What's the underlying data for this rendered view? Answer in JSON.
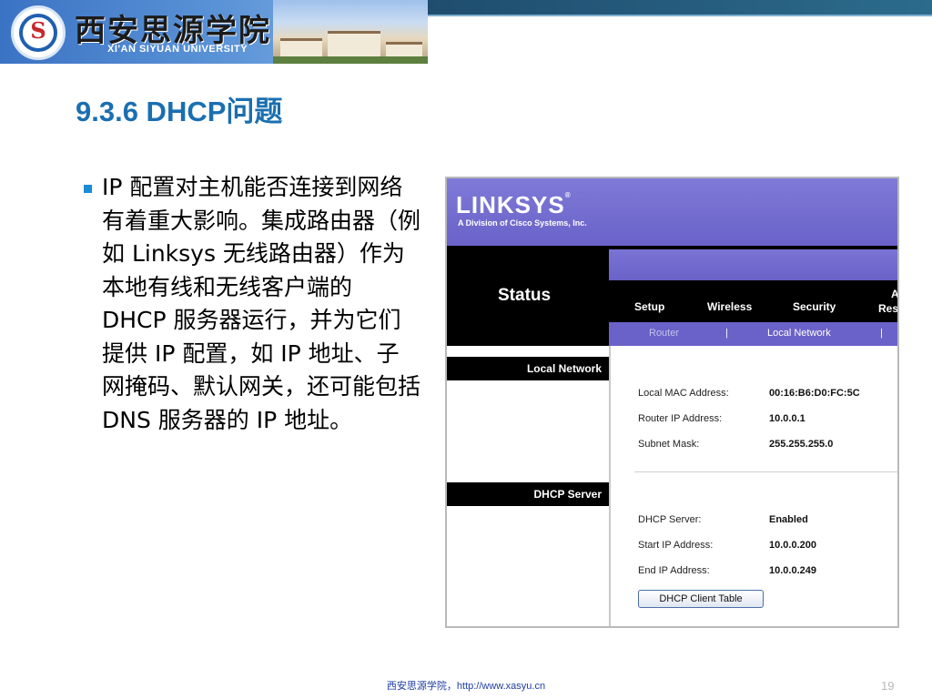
{
  "header": {
    "logo_mark": "S",
    "title": "西安思源学院",
    "subtitle": "XI'AN SIYUAN UNIVERSITY"
  },
  "slide": {
    "title": "9.3.6 DHCP问题",
    "bullet_text": "IP 配置对主机能否连接到网络有着重大影响。集成路由器（例如 Linksys 无线路由器）作为本地有线和无线客户端的 DHCP 服务器运行，并为它们提供 IP 配置，如 IP 地址、子网掩码、默认网关，还可能包括 DNS 服务器的 IP 地址。",
    "bullet_icon": "square-bullet-icon",
    "bullet_color": "#1a8bd6",
    "title_color": "#1a6fb0"
  },
  "router_ui": {
    "brand": "LINKSYS",
    "brand_mark": "®",
    "tagline": "A Division of Cisco Systems, Inc.",
    "page_label": "Status",
    "tabs": [
      "Setup",
      "Wireless",
      "Security",
      "A",
      "Res"
    ],
    "subtabs": [
      "Router",
      "|",
      "Local Network",
      "|"
    ],
    "sections": [
      "Local Network",
      "DHCP Server"
    ],
    "local_network": [
      {
        "label": "Local MAC Address:",
        "value": "00:16:B6:D0:FC:5C"
      },
      {
        "label": "Router IP Address:",
        "value": "10.0.0.1"
      },
      {
        "label": "Subnet Mask:",
        "value": "255.255.255.0"
      }
    ],
    "dhcp": [
      {
        "label": "DHCP Server:",
        "value": "Enabled"
      },
      {
        "label": "Start IP Address:",
        "value": "10.0.0.200"
      },
      {
        "label": "End IP Address:",
        "value": "10.0.0.249"
      }
    ],
    "button_label": "DHCP Client Table",
    "accent_color": "#6a62c8"
  },
  "footer": {
    "text": "西安思源学院，http://www.xasyu.cn",
    "page_number": "19"
  }
}
